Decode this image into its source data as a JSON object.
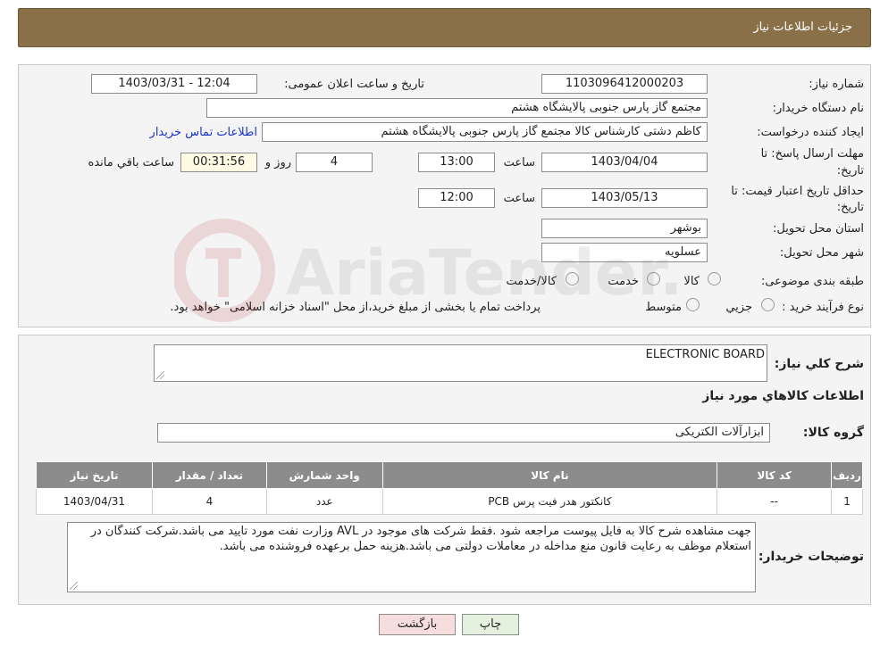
{
  "header": {
    "title": "جزئیات اطلاعات نیاز"
  },
  "info": {
    "need_number_label": "شماره نیاز:",
    "need_number": "1103096412000203",
    "announce_label": "تاریخ و ساعت اعلان عمومی:",
    "announce_value": "1403/03/31 - 12:04",
    "buyer_org_label": "نام دستگاه خریدار:",
    "buyer_org": "مجتمع گاز پارس جنوبی  پالایشگاه هشتم",
    "requester_label": "ایجاد کننده درخواست:",
    "requester": "کاظم دشتی کارشناس کالا مجتمع گاز پارس جنوبی  پالایشگاه هشتم",
    "contact_link": "اطلاعات تماس خریدار",
    "deadline_label_1": "مهلت ارسال پاسخ: تا",
    "deadline_label_2": "تاریخ:",
    "deadline_date": "1403/04/04",
    "time_label": "ساعت",
    "deadline_time": "13:00",
    "days_value": "4",
    "days_label": "روز و",
    "remaining_time": "00:31:56",
    "remaining_label": "ساعت باقي مانده",
    "validity_label_1": "حداقل تاریخ اعتبار قیمت: تا",
    "validity_label_2": "تاریخ:",
    "validity_date": "1403/05/13",
    "validity_time": "12:00",
    "province_label": "استان محل تحویل:",
    "province": "بوشهر",
    "city_label": "شهر محل تحویل:",
    "city": "عسلویه",
    "category_label": "طبقه بندی موضوعی:",
    "category_options": [
      "کالا",
      "خدمت",
      "کالا/خدمت"
    ],
    "process_label": "نوع فرآیند خرید :",
    "process_options": [
      "جزیي",
      "متوسط"
    ],
    "process_note": "پرداخت تمام یا بخشی از مبلغ خرید،از محل \"اسناد خزانه اسلامی\" خواهد بود."
  },
  "details": {
    "summary_label": "شرح كلي نياز:",
    "summary": "ELECTRONIC BOARD",
    "items_heading": "اطلاعات كالاهاي مورد نياز",
    "group_label": "گروه کالا:",
    "group_value": "ابزارآلات الکتریکی",
    "table": {
      "headers": [
        "رديف",
        "کد کالا",
        "نام کالا",
        "واحد شمارش",
        "تعداد / مقدار",
        "تاریخ نیاز"
      ],
      "rows": [
        [
          "1",
          "--",
          "کانکتور هدر فیت پرس PCB",
          "عدد",
          "4",
          "1403/04/31"
        ]
      ]
    },
    "buyer_notes_label": "توضیحات خریدار:",
    "buyer_notes": "جهت مشاهده شرح کالا به فایل پیوست مراجعه شود .فقط شرکت های موجود در AVL وزارت نفت مورد تایید می باشد.شرکت کنندگان در استعلام موظف به رعایت قانون منع مداخله در معاملات دولتی می باشد.هزینه حمل برعهده فروشنده می باشد."
  },
  "buttons": {
    "print": "چاپ",
    "back": "بازگشت"
  },
  "watermark": {
    "text": "AriaTender.neT"
  },
  "colors": {
    "header": "#8a7049",
    "back_button": "#f7dede",
    "print_button": "#e4f1df",
    "link": "#1a33cc"
  }
}
